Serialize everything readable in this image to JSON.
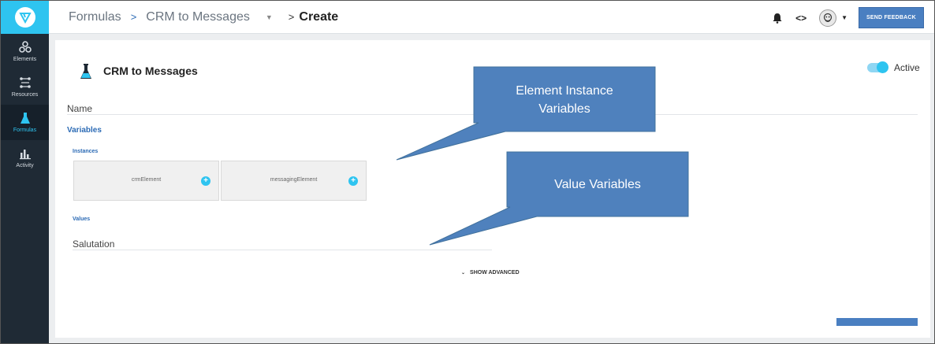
{
  "sidebar": {
    "items": [
      {
        "label": "Elements"
      },
      {
        "label": "Resources"
      },
      {
        "label": "Formulas"
      },
      {
        "label": "Activity"
      }
    ]
  },
  "topbar": {
    "crumb_formulas": "Formulas",
    "crumb_separator": ">",
    "crumb_formula": "CRM to Messages",
    "crumb_current_prefix": ">",
    "crumb_current": "Create",
    "feedback_label": "SEND FEEDBACK"
  },
  "page": {
    "title": "CRM to Messages",
    "toggle_label": "Active",
    "toggle_on": true,
    "name_label": "Name",
    "variables_label": "Variables",
    "instances_label": "Instances",
    "instances": [
      {
        "name": "crmElement"
      },
      {
        "name": "messagingElement"
      }
    ],
    "values_label": "Values",
    "value_field_label": "Salutation",
    "show_advanced": "SHOW ADVANCED"
  },
  "callouts": [
    {
      "line1": "Element Instance",
      "line2": "Variables"
    },
    {
      "line1": "Value Variables"
    }
  ],
  "colors": {
    "sidebar_bg": "#1f2a35",
    "accent_cyan": "#2ec4f0",
    "link_blue": "#2c6bb5",
    "button_blue": "#4a7fc1",
    "callout_blue": "#4f81bd"
  },
  "icons": {
    "logo": "brand-logo-icon",
    "elements": "elements-icon",
    "resources": "resources-icon",
    "formulas": "flask-icon",
    "activity": "bar-chart-icon",
    "notifications": "bell-icon",
    "code": "code-icon",
    "add": "plus-icon"
  }
}
